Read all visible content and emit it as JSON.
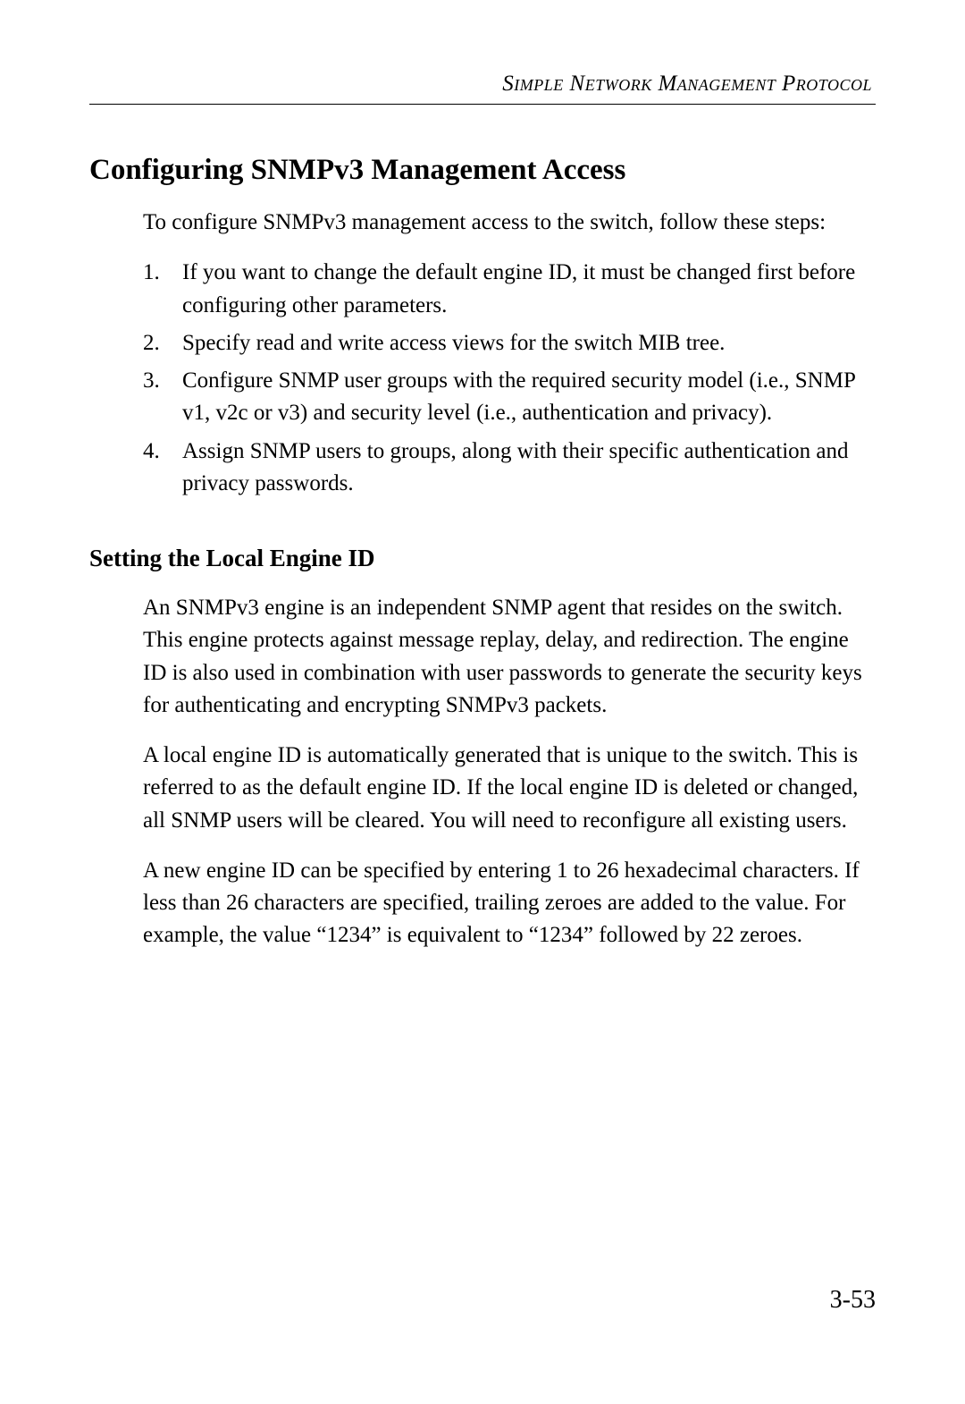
{
  "running_header": "Simple Network Management Protocol",
  "section_heading": "Configuring SNMPv3 Management Access",
  "intro_text": "To configure SNMPv3 management access to the switch, follow these steps:",
  "steps": [
    {
      "num": "1.",
      "text": "If you want to change the default engine ID, it must be changed first before configuring other parameters."
    },
    {
      "num": "2.",
      "text": "Specify read and write access views for the switch MIB tree."
    },
    {
      "num": "3.",
      "text": "Configure SNMP user groups with the required security model (i.e., SNMP v1, v2c or v3) and security level (i.e., authentication and privacy)."
    },
    {
      "num": "4.",
      "text": "Assign SNMP users to groups, along with their specific authentication and privacy passwords."
    }
  ],
  "subsection_heading": "Setting the Local Engine ID",
  "para_1": "An SNMPv3 engine is an independent SNMP agent that resides on the switch. This engine protects against message replay, delay, and redirection. The engine ID is also used in combination with user passwords to generate the security keys for authenticating and encrypting SNMPv3 packets.",
  "para_2": "A local engine ID is automatically generated that is unique to the switch. This is referred to as the default engine ID. If the local engine ID is deleted or changed, all SNMP users will be cleared. You will need to reconfigure all existing users.",
  "para_3": "A new engine ID can be specified by entering 1 to 26 hexadecimal characters. If less than 26 characters are specified, trailing zeroes are added to the value. For example, the value “1234” is equivalent to “1234” followed by 22 zeroes.",
  "page_number": "3-53"
}
